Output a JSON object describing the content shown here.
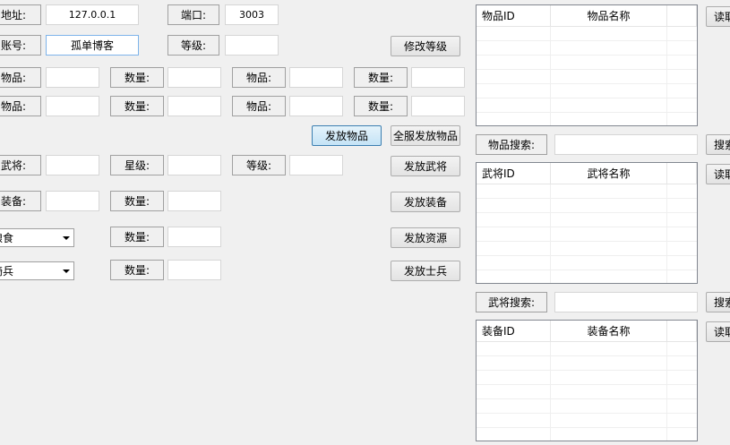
{
  "server": {
    "address_label": "地址:",
    "address_value": "127.0.0.1",
    "port_label": "端口:",
    "port_value": "3003"
  },
  "account": {
    "account_label": "账号:",
    "account_value": "孤单博客",
    "level_label": "等级:",
    "level_value": "",
    "modify_level_button": "修改等级"
  },
  "items": {
    "rows": [
      {
        "item1_label": "物品:",
        "qty1_label": "数量:",
        "item2_label": "物品:",
        "qty2_label": "数量:"
      },
      {
        "item1_label": "物品:",
        "qty1_label": "数量:",
        "item2_label": "物品:",
        "qty2_label": "数量:"
      }
    ],
    "send_button": "发放物品",
    "send_all_button": "全服发放物品"
  },
  "general": {
    "general_label": "武将:",
    "star_label": "星级:",
    "level_label": "等级:",
    "send_button": "发放武将"
  },
  "equipment": {
    "equip_label": "装备:",
    "qty_label": "数量:",
    "send_button": "发放装备"
  },
  "resource": {
    "selected": "粮食",
    "qty_label": "数量:",
    "send_button": "发放资源"
  },
  "soldier": {
    "selected": "骑兵",
    "qty_label": "数量:",
    "send_button": "发放士兵"
  },
  "item_list": {
    "columns": [
      "物品ID",
      "物品名称",
      ""
    ],
    "read_button": "读取",
    "search_label": "物品搜索:",
    "search_value": "",
    "search_button": "搜索"
  },
  "general_list": {
    "columns": [
      "武将ID",
      "武将名称",
      ""
    ],
    "read_button": "读取",
    "search_label": "武将搜索:",
    "search_value": "",
    "search_button": "搜索"
  },
  "equip_list": {
    "columns": [
      "装备ID",
      "装备名称",
      ""
    ],
    "read_button": "读取"
  },
  "colors": {
    "window_bg": "#f0f0f0",
    "active_button_bg": "#c4e3f6",
    "focus_border": "#7eb4ea"
  }
}
